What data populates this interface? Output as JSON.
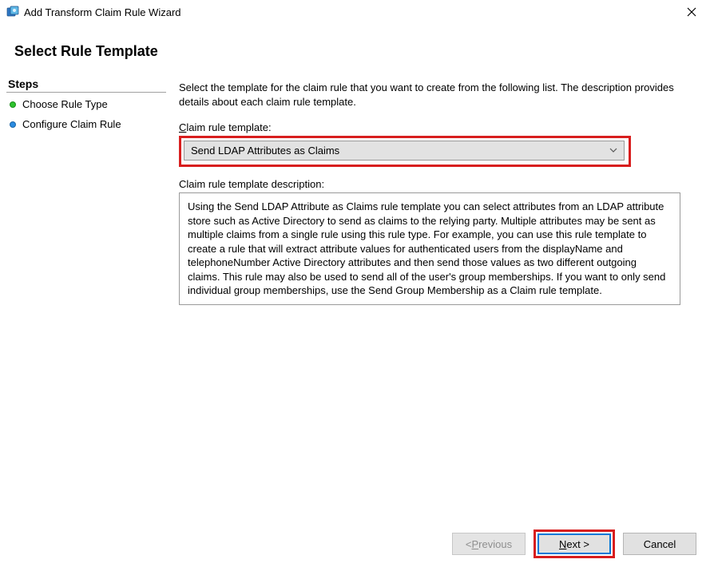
{
  "titlebar": {
    "title": "Add Transform Claim Rule Wizard"
  },
  "header": {
    "title": "Select Rule Template"
  },
  "sidebar": {
    "title": "Steps",
    "steps": [
      {
        "label": "Choose Rule Type"
      },
      {
        "label": "Configure Claim Rule"
      }
    ]
  },
  "main": {
    "intro": "Select the template for the claim rule that you want to create from the following list. The description provides details about each claim rule template.",
    "template_label_pre": "",
    "template_label_u": "C",
    "template_label_post": "laim rule template:",
    "selected_template": "Send LDAP Attributes as Claims",
    "desc_label": "Claim rule template description:",
    "desc": "Using the Send LDAP Attribute as Claims rule template you can select attributes from an LDAP attribute store such as Active Directory to send as claims to the relying party. Multiple attributes may be sent as multiple claims from a single rule using this rule type. For example, you can use this rule template to create a rule that will extract attribute values for authenticated users from the displayName and telephoneNumber Active Directory attributes and then send those values as two different outgoing claims. This rule may also be used to send all of the user's group memberships. If you want to only send individual group memberships, use the Send Group Membership as a Claim rule template."
  },
  "buttons": {
    "previous_pre": "< ",
    "previous_u": "P",
    "previous_post": "revious",
    "next_u": "N",
    "next_post": "ext >",
    "cancel": "Cancel"
  }
}
